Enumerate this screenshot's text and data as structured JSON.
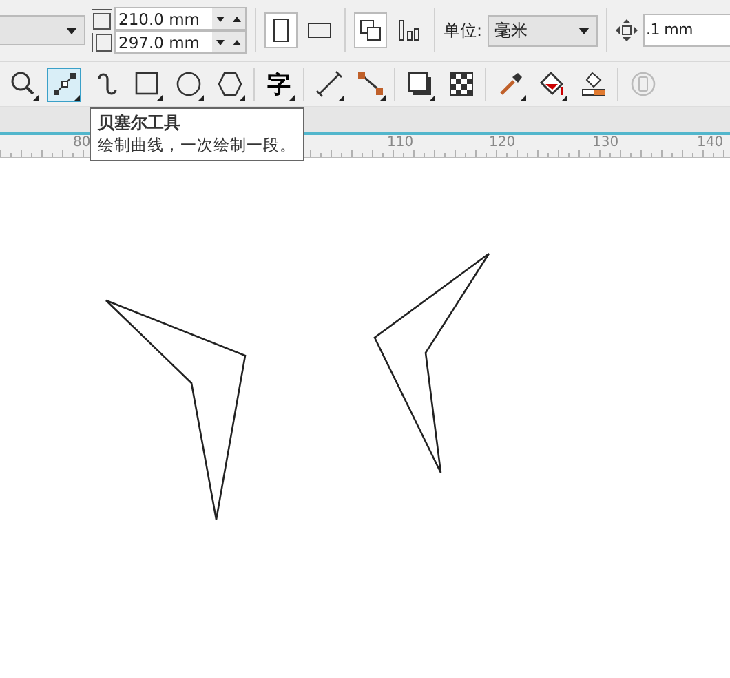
{
  "property_bar": {
    "width": "210.0 mm",
    "height": "297.0 mm",
    "orientation": [
      {
        "kind": "portrait",
        "selected": true
      },
      {
        "kind": "landscape",
        "selected": false
      }
    ],
    "unit_label": "单位:",
    "unit_value": "毫米",
    "nudge": ".1 mm"
  },
  "toolbox": [
    {
      "kind": "zoom",
      "selected": false,
      "disabled": false
    },
    {
      "kind": "bezier",
      "selected": true,
      "disabled": false
    },
    {
      "kind": "freehand",
      "selected": false,
      "disabled": false
    },
    {
      "kind": "rectangle",
      "selected": false,
      "disabled": false
    },
    {
      "kind": "ellipse",
      "selected": false,
      "disabled": false
    },
    {
      "kind": "polygon",
      "selected": false,
      "disabled": false
    },
    {
      "kind": "text",
      "label": "字",
      "selected": false,
      "disabled": false
    },
    {
      "kind": "dimension",
      "selected": false,
      "disabled": false
    },
    {
      "kind": "connector",
      "selected": false,
      "disabled": false
    },
    {
      "kind": "shadow",
      "selected": false,
      "disabled": false
    },
    {
      "kind": "transparency",
      "selected": false,
      "disabled": false
    },
    {
      "kind": "eyedropper",
      "selected": false,
      "disabled": false
    },
    {
      "kind": "fill",
      "selected": false,
      "disabled": false
    },
    {
      "kind": "smartfill",
      "selected": false,
      "disabled": false
    },
    {
      "kind": "outline",
      "selected": false,
      "disabled": true
    }
  ],
  "tooltip": {
    "title": "贝塞尔工具",
    "text": "绘制曲线，一次绘制一段。"
  },
  "ruler": {
    "labels": [
      "80",
      "110",
      "120",
      "130",
      "140"
    ]
  }
}
